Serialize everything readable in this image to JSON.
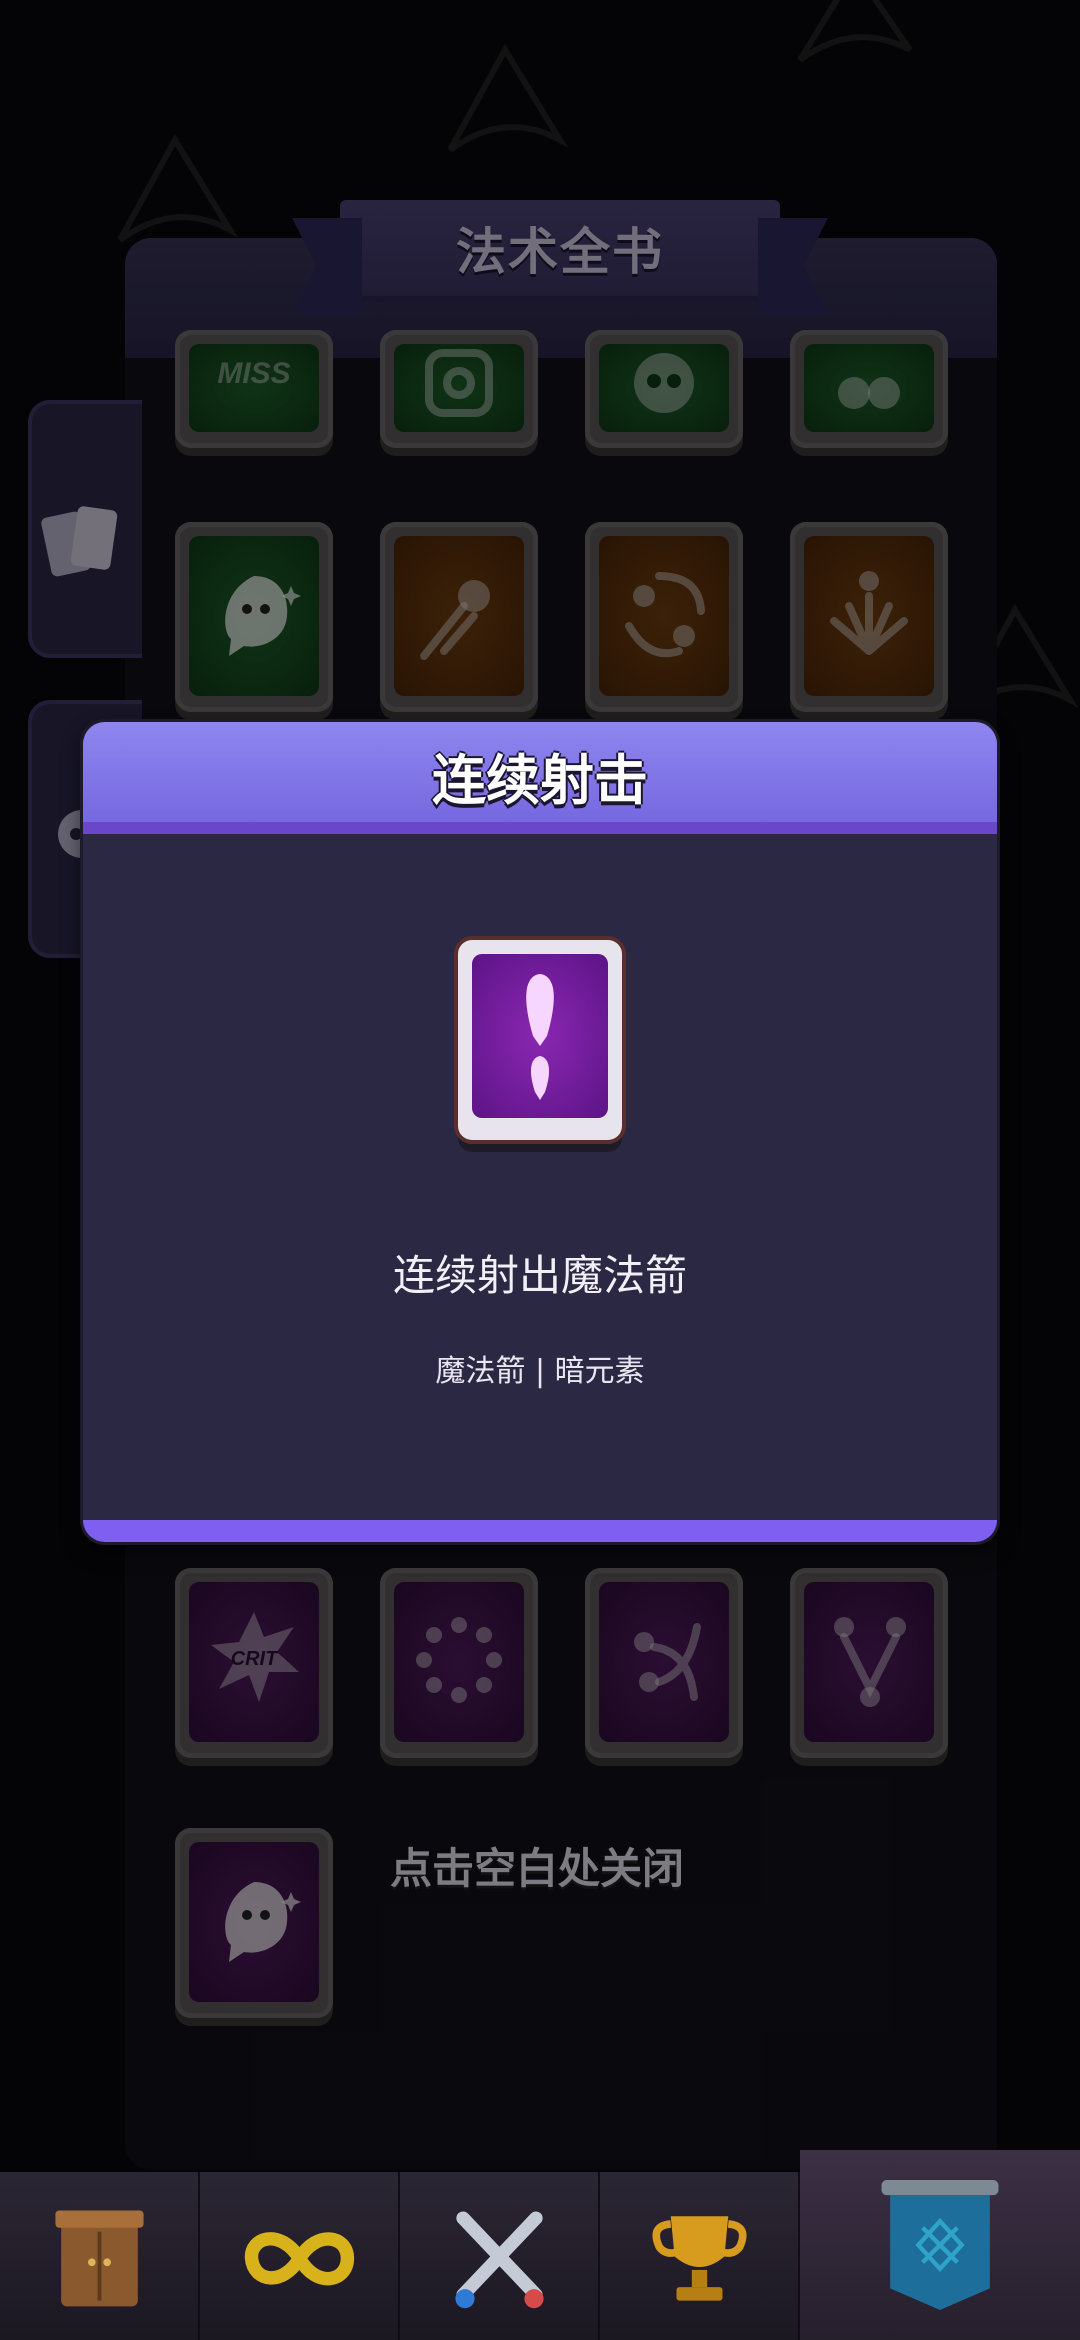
{
  "book": {
    "title": "法术全书"
  },
  "dialog": {
    "title": "连续射击",
    "description": "连续射出魔法箭",
    "tags": "魔法箭 | 暗元素"
  },
  "hint": "点击空白处关闭",
  "cards": [
    {
      "row": 0,
      "col": 0,
      "color": "green",
      "icon": "miss-icon",
      "label": "MISS"
    },
    {
      "row": 0,
      "col": 1,
      "color": "green",
      "icon": "target-icon"
    },
    {
      "row": 0,
      "col": 2,
      "color": "green",
      "icon": "skull-icon"
    },
    {
      "row": 0,
      "col": 3,
      "color": "green",
      "icon": "paws-icon"
    },
    {
      "row": 1,
      "col": 0,
      "color": "green",
      "icon": "ghost-icon"
    },
    {
      "row": 1,
      "col": 1,
      "color": "orange",
      "icon": "fireball-icon"
    },
    {
      "row": 1,
      "col": 2,
      "color": "orange",
      "icon": "orbit-icon"
    },
    {
      "row": 1,
      "col": 3,
      "color": "orange",
      "icon": "burst-icon"
    },
    {
      "row": 2,
      "col": 0,
      "color": "purple",
      "icon": "crit-icon",
      "label": "CRIT"
    },
    {
      "row": 2,
      "col": 1,
      "color": "purple",
      "icon": "ring-icon"
    },
    {
      "row": 2,
      "col": 2,
      "color": "purple",
      "icon": "splash-icon"
    },
    {
      "row": 2,
      "col": 3,
      "color": "purple",
      "icon": "chain-icon"
    },
    {
      "row": 3,
      "col": 0,
      "color": "purple",
      "icon": "ghost-icon"
    }
  ],
  "nav": [
    {
      "icon": "cabinet-icon",
      "active": false
    },
    {
      "icon": "infinity-icon",
      "active": false
    },
    {
      "icon": "crossed-swords-icon",
      "active": false
    },
    {
      "icon": "trophy-icon",
      "active": false
    },
    {
      "icon": "banner-shield-icon",
      "active": true
    }
  ],
  "colors": {
    "dialog_header": "#8f86ef",
    "dialog_body": "#2b2843",
    "card_green": "#1e5e2a",
    "card_orange": "#6e3d10",
    "card_purple": "#4f1a5d",
    "accent_purple": "#7f5ff0"
  }
}
